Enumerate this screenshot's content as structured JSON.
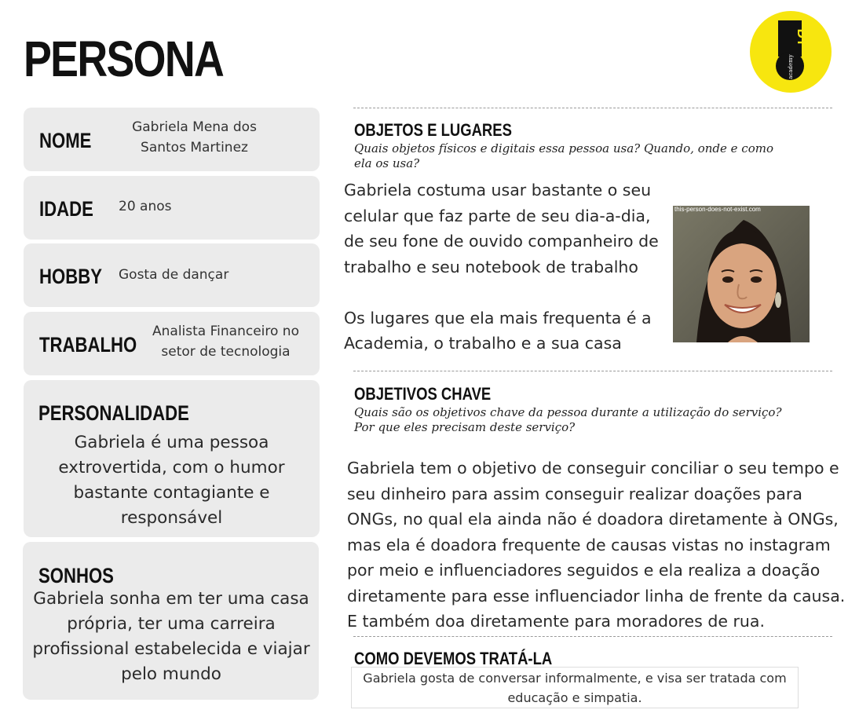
{
  "page": {
    "title": "PERSONA",
    "logo": {
      "icon": "dt-academy-logo-icon",
      "text_top": "DT",
      "text_sub": "academy",
      "color": "#f7e60f"
    }
  },
  "cards": {
    "nome": {
      "label": "NOME",
      "value_line1": "Gabriela Mena dos",
      "value_line2": "Santos Martinez"
    },
    "idade": {
      "label": "IDADE",
      "value": "20 anos"
    },
    "hobby": {
      "label": "HOBBY",
      "value": "Gosta de dançar"
    },
    "trabalho": {
      "label": "TRABALHO",
      "value_line1": "Analista Financeiro no",
      "value_line2": "setor de tecnologia"
    },
    "personalidade": {
      "label": "PERSONALIDADE",
      "lines": [
        "Gabriela é uma pessoa",
        "extrovertida, com o humor",
        "bastante contagiante e",
        "responsável"
      ]
    },
    "sonhos": {
      "label": "SONHOS",
      "lines": [
        "Gabriela sonha em ter uma casa",
        "própria, ter uma carreira",
        "profissional estabelecida e viajar",
        "pelo mundo"
      ]
    }
  },
  "objetos": {
    "title": "OBJETOS E LUGARES",
    "question_line1": "Quais objetos físicos e digitais essa pessoa usa? Quando, onde e como",
    "question_line2": "ela os usa?",
    "lines": [
      "Gabriela costuma usar bastante o seu",
      "celular que faz parte de seu dia-a-dia,",
      "de seu fone de ouvido companheiro de",
      "trabalho e seu notebook de trabalho"
    ],
    "lines2": [
      "Os lugares que ela mais frequenta é a",
      "Academia, o trabalho e a sua casa"
    ],
    "photo_watermark": "this-person-does-not-exist.com"
  },
  "objetivos": {
    "title": "OBJETIVOS CHAVE",
    "question_line1": "Quais são os objetivos chave da pessoa durante a utilização do serviço?",
    "question_line2": "Por que eles precisam deste serviço?",
    "lines": [
      "Gabriela tem o objetivo de conseguir conciliar o seu tempo e",
      "seu dinheiro para assim conseguir realizar doações para",
      "ONGs, no qual ela ainda não é doadora diretamente à ONGs,",
      "mas ela é doadora frequente de causas vistas no instagram",
      "por meio e influenciadores seguidos e ela realiza a doação",
      "diretamente para esse influenciador linha de frente da causa.",
      "E também doa diretamente para moradores de rua."
    ]
  },
  "tratamento": {
    "title": "COMO DEVEMOS TRATÁ-LA",
    "line1": "Gabriela gosta de conversar informalmente, e visa ser tratada com",
    "line2": "educação e simpatia."
  }
}
